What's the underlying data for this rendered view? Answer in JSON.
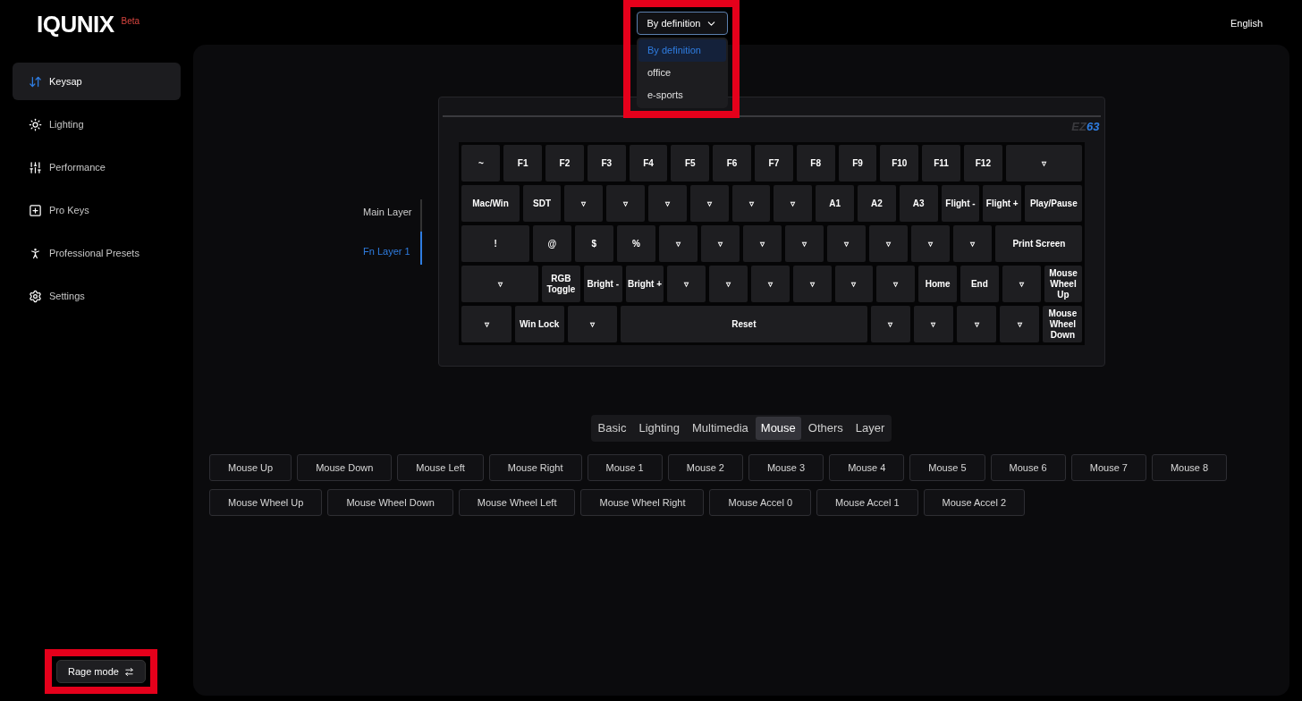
{
  "brand": {
    "name": "IQUNIX",
    "badge": "Beta"
  },
  "sidebar": {
    "items": [
      {
        "label": "Keysap",
        "kind": "keymap",
        "selected": true
      },
      {
        "label": "Lighting",
        "kind": "lighting",
        "selected": false
      },
      {
        "label": "Performance",
        "kind": "performance",
        "selected": false
      },
      {
        "label": "Pro Keys",
        "kind": "prokeys",
        "selected": false
      },
      {
        "label": "Professional Presets",
        "kind": "presets",
        "selected": false
      },
      {
        "label": "Settings",
        "kind": "settings",
        "selected": false
      }
    ],
    "rage_mode": "Rage mode"
  },
  "preset_dropdown": {
    "value": "By definition",
    "expanded": true,
    "options": [
      {
        "label": "By definition",
        "selected": true
      },
      {
        "label": "office",
        "selected": false
      },
      {
        "label": "e-sports",
        "selected": false
      }
    ]
  },
  "language": "English",
  "layers": [
    {
      "label": "Main Layer",
      "selected": false
    },
    {
      "label": "Fn Layer 1",
      "selected": true
    }
  ],
  "keyboard": {
    "model_prefix": "EZ",
    "model_number": "63",
    "rows": [
      {
        "keys": [
          {
            "label": "~",
            "kind": "key"
          },
          {
            "label": "F1",
            "kind": "key"
          },
          {
            "label": "F2",
            "kind": "key"
          },
          {
            "label": "F3",
            "kind": "key"
          },
          {
            "label": "F4",
            "kind": "key"
          },
          {
            "label": "F5",
            "kind": "key"
          },
          {
            "label": "F6",
            "kind": "key"
          },
          {
            "label": "F7",
            "kind": "key"
          },
          {
            "label": "F8",
            "kind": "key"
          },
          {
            "label": "F9",
            "kind": "key"
          },
          {
            "label": "F10",
            "kind": "key"
          },
          {
            "label": "F11",
            "kind": "key"
          },
          {
            "label": "F12",
            "kind": "key"
          },
          {
            "label": "▿",
            "kind": "backspace"
          }
        ]
      },
      {
        "keys": [
          {
            "label": "Mac/Win",
            "kind": "tab"
          },
          {
            "label": "SDT",
            "kind": "key"
          },
          {
            "label": "▿",
            "kind": "key"
          },
          {
            "label": "▿",
            "kind": "key"
          },
          {
            "label": "▿",
            "kind": "key"
          },
          {
            "label": "▿",
            "kind": "key"
          },
          {
            "label": "▿",
            "kind": "key"
          },
          {
            "label": "▿",
            "kind": "key"
          },
          {
            "label": "A1",
            "kind": "key"
          },
          {
            "label": "A2",
            "kind": "key"
          },
          {
            "label": "A3",
            "kind": "key"
          },
          {
            "label": "Flight -",
            "kind": "key"
          },
          {
            "label": "Flight +",
            "kind": "key"
          },
          {
            "label": "Play/Pause",
            "kind": "tab"
          }
        ]
      },
      {
        "keys": [
          {
            "label": "!",
            "kind": "caps"
          },
          {
            "label": "@",
            "kind": "key"
          },
          {
            "label": "$",
            "kind": "key"
          },
          {
            "label": "%",
            "kind": "key"
          },
          {
            "label": "▿",
            "kind": "key"
          },
          {
            "label": "▿",
            "kind": "key"
          },
          {
            "label": "▿",
            "kind": "key"
          },
          {
            "label": "▿",
            "kind": "key"
          },
          {
            "label": "▿",
            "kind": "key"
          },
          {
            "label": "▿",
            "kind": "key"
          },
          {
            "label": "▿",
            "kind": "key"
          },
          {
            "label": "▿",
            "kind": "key"
          },
          {
            "label": "Print Screen",
            "kind": "enter"
          }
        ]
      },
      {
        "keys": [
          {
            "label": "▿",
            "kind": "shift"
          },
          {
            "label": "RGB Toggle",
            "kind": "key"
          },
          {
            "label": "Bright -",
            "kind": "key"
          },
          {
            "label": "Bright +",
            "kind": "key"
          },
          {
            "label": "▿",
            "kind": "key"
          },
          {
            "label": "▿",
            "kind": "key"
          },
          {
            "label": "▿",
            "kind": "key"
          },
          {
            "label": "▿",
            "kind": "key"
          },
          {
            "label": "▿",
            "kind": "key"
          },
          {
            "label": "▿",
            "kind": "key"
          },
          {
            "label": "Home",
            "kind": "key"
          },
          {
            "label": "End",
            "kind": "key"
          },
          {
            "label": "▿",
            "kind": "key"
          },
          {
            "label": "Mouse Wheel Up",
            "kind": "key"
          }
        ]
      },
      {
        "keys": [
          {
            "label": "▿",
            "kind": "mod"
          },
          {
            "label": "Win Lock",
            "kind": "mod"
          },
          {
            "label": "▿",
            "kind": "mod"
          },
          {
            "label": "Reset",
            "kind": "space"
          },
          {
            "label": "▿",
            "kind": "key"
          },
          {
            "label": "▿",
            "kind": "key"
          },
          {
            "label": "▿",
            "kind": "key"
          },
          {
            "label": "▿",
            "kind": "key"
          },
          {
            "label": "Mouse Wheel Down",
            "kind": "key"
          }
        ]
      }
    ]
  },
  "tabs": [
    {
      "label": "Basic",
      "selected": false
    },
    {
      "label": "Lighting",
      "selected": false
    },
    {
      "label": "Multimedia",
      "selected": false
    },
    {
      "label": "Mouse",
      "selected": true
    },
    {
      "label": "Others",
      "selected": false
    },
    {
      "label": "Layer",
      "selected": false
    }
  ],
  "key_options": [
    [
      "Mouse Up",
      "Mouse Down",
      "Mouse Left",
      "Mouse Right",
      "Mouse 1",
      "Mouse 2",
      "Mouse 3",
      "Mouse 4",
      "Mouse 5",
      "Mouse 6",
      "Mouse 7",
      "Mouse 8"
    ],
    [
      "Mouse Wheel Up",
      "Mouse Wheel Down",
      "Mouse Wheel Left",
      "Mouse Wheel Right",
      "Mouse Accel 0",
      "Mouse Accel 1",
      "Mouse Accel 2"
    ]
  ]
}
